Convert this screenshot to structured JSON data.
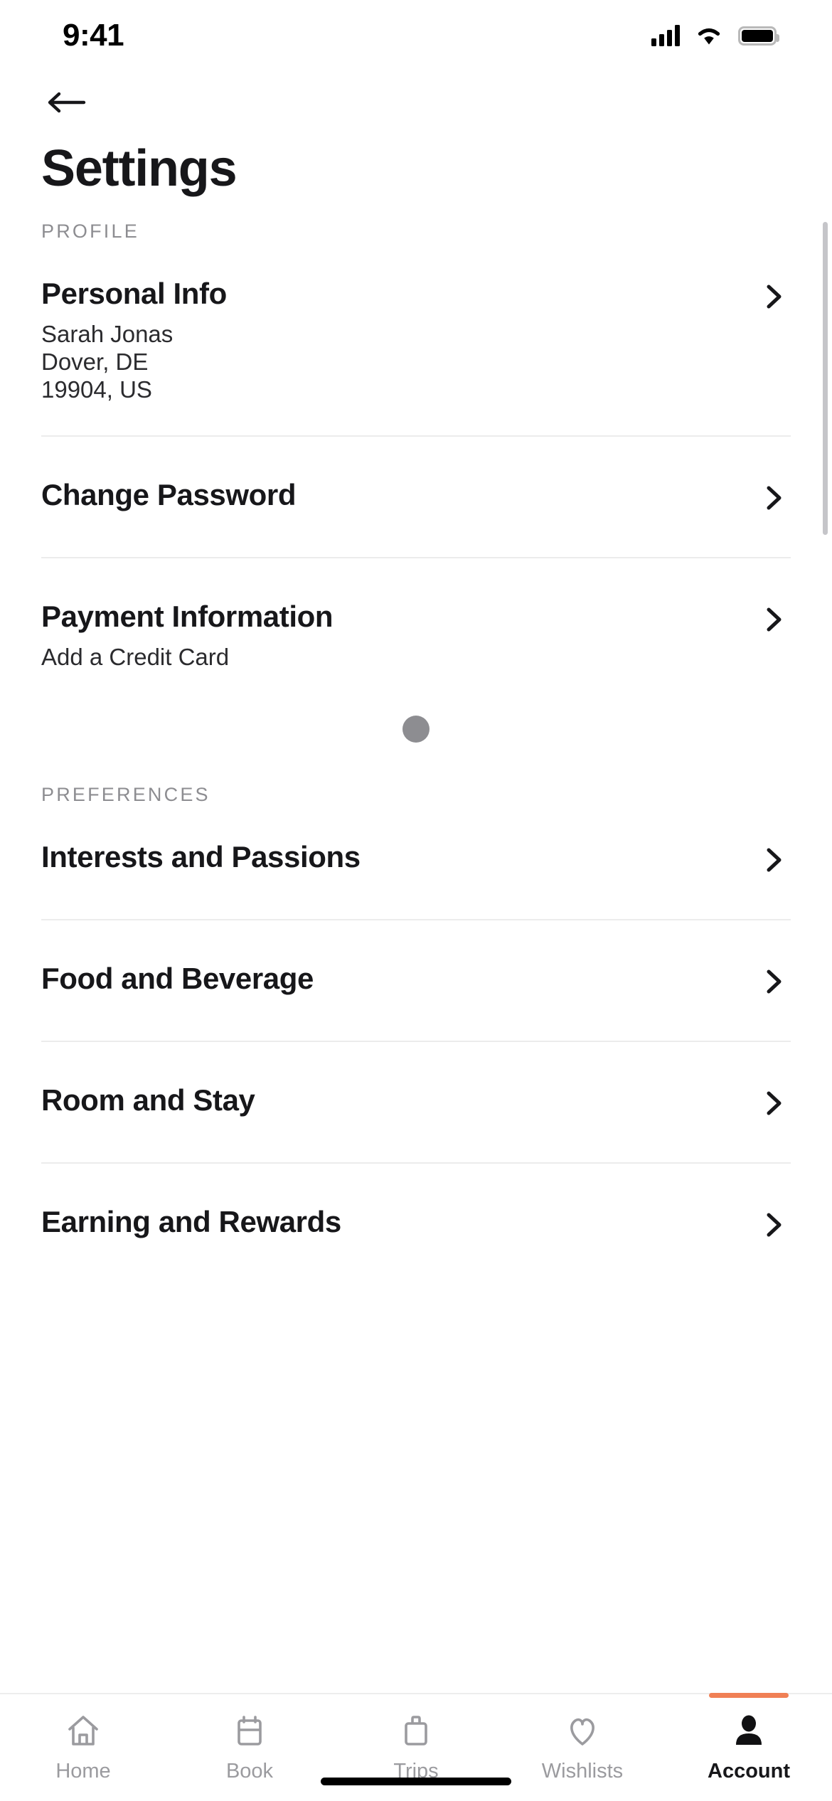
{
  "status_bar": {
    "time": "9:41",
    "cellular_icon": "signal-bars-icon",
    "wifi_icon": "wifi-icon",
    "battery_icon": "battery-icon"
  },
  "header": {
    "back_icon": "arrow-left-icon",
    "title": "Settings"
  },
  "sections": [
    {
      "label": "PROFILE",
      "rows": [
        {
          "title": "Personal Info",
          "sub_lines": [
            "Sarah Jonas",
            "Dover, DE",
            "19904, US"
          ],
          "chevron_icon": "chevron-right-icon"
        },
        {
          "title": "Change Password",
          "sub_lines": [],
          "chevron_icon": "chevron-right-icon"
        },
        {
          "title": "Payment Information",
          "sub_lines": [
            "Add a Credit Card"
          ],
          "chevron_icon": "chevron-right-icon"
        }
      ]
    },
    {
      "label": "PREFERENCES",
      "rows": [
        {
          "title": "Interests and Passions",
          "sub_lines": [],
          "chevron_icon": "chevron-right-icon"
        },
        {
          "title": "Food and Beverage",
          "sub_lines": [],
          "chevron_icon": "chevron-right-icon"
        },
        {
          "title": "Room and Stay",
          "sub_lines": [],
          "chevron_icon": "chevron-right-icon"
        },
        {
          "title": "Earning and Rewards",
          "sub_lines": [],
          "chevron_icon": "chevron-right-icon"
        }
      ]
    }
  ],
  "tab_bar": {
    "active_index": 4,
    "indicator_color": "#f08055",
    "items": [
      {
        "label": "Home",
        "icon": "house-icon"
      },
      {
        "label": "Book",
        "icon": "calendar-icon"
      },
      {
        "label": "Trips",
        "icon": "suitcase-icon"
      },
      {
        "label": "Wishlists",
        "icon": "heart-icon"
      },
      {
        "label": "Account",
        "icon": "person-icon"
      }
    ]
  },
  "colors": {
    "accent": "#f08055",
    "text_primary": "#17171a",
    "text_muted": "#8d8d91",
    "divider": "#ececec",
    "scrollbar": "#c5c5c9"
  }
}
